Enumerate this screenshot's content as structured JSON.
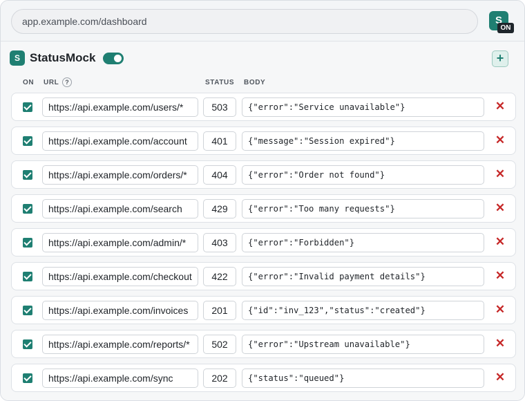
{
  "browser": {
    "url": "app.example.com/dashboard",
    "extension_icon_text": "S",
    "extension_badge": "ON"
  },
  "app": {
    "logo_text": "S",
    "title": "StatusMock",
    "enabled": true,
    "add_label": "+"
  },
  "headers": {
    "on": "ON",
    "url": "URL",
    "help": "?",
    "status": "STATUS",
    "body": "BODY"
  },
  "delete_glyph": "✕",
  "rules": [
    {
      "enabled": true,
      "url": "https://api.example.com/users/*",
      "status": "503",
      "body": "{\"error\":\"Service unavailable\"}"
    },
    {
      "enabled": true,
      "url": "https://api.example.com/account",
      "status": "401",
      "body": "{\"message\":\"Session expired\"}"
    },
    {
      "enabled": true,
      "url": "https://api.example.com/orders/*",
      "status": "404",
      "body": "{\"error\":\"Order not found\"}"
    },
    {
      "enabled": true,
      "url": "https://api.example.com/search",
      "status": "429",
      "body": "{\"error\":\"Too many requests\"}"
    },
    {
      "enabled": true,
      "url": "https://api.example.com/admin/*",
      "status": "403",
      "body": "{\"error\":\"Forbidden\"}"
    },
    {
      "enabled": true,
      "url": "https://api.example.com/checkout",
      "status": "422",
      "body": "{\"error\":\"Invalid payment details\"}"
    },
    {
      "enabled": true,
      "url": "https://api.example.com/invoices",
      "status": "201",
      "body": "{\"id\":\"inv_123\",\"status\":\"created\"}"
    },
    {
      "enabled": true,
      "url": "https://api.example.com/reports/*",
      "status": "502",
      "body": "{\"error\":\"Upstream unavailable\"}"
    },
    {
      "enabled": true,
      "url": "https://api.example.com/sync",
      "status": "202",
      "body": "{\"status\":\"queued\"}"
    }
  ],
  "colors": {
    "accent": "#1f7f72",
    "delete": "#c62828"
  }
}
